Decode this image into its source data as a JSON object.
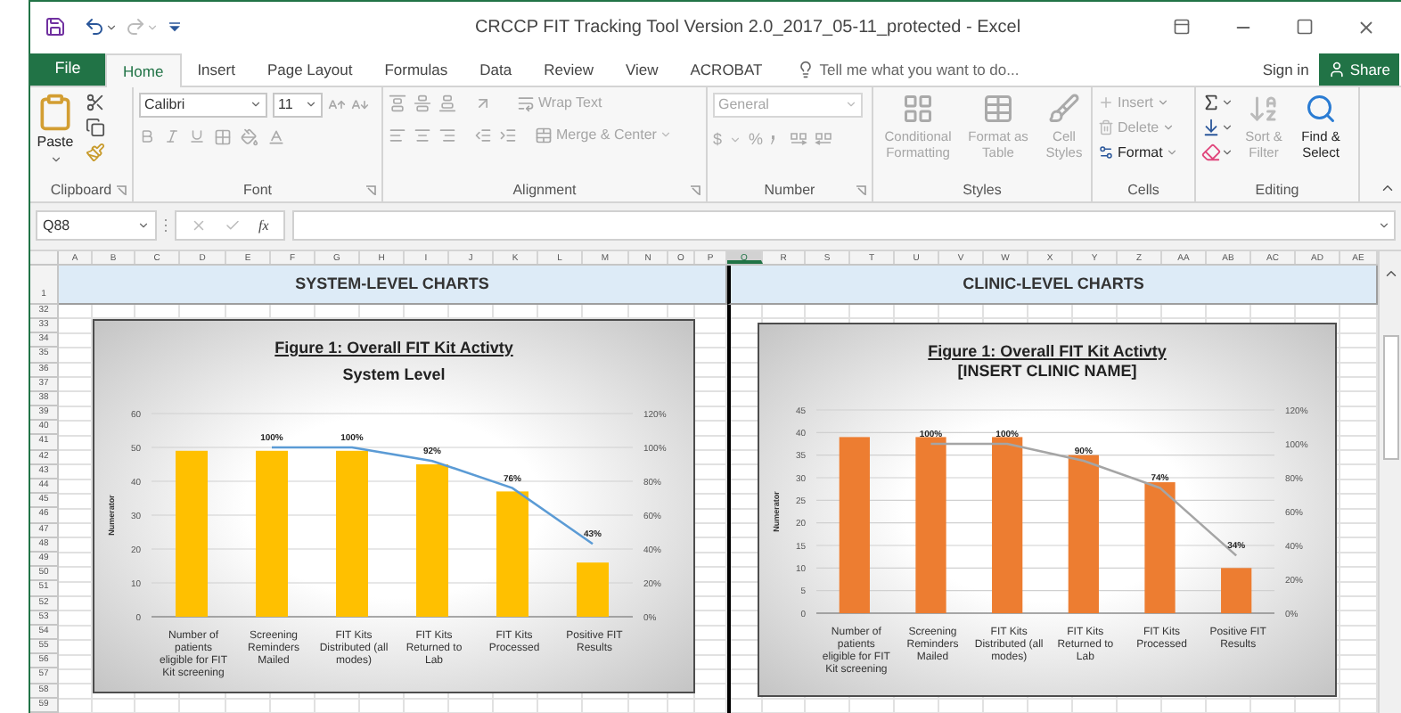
{
  "window": {
    "title": "CRCCP FIT Tracking Tool Version 2.0_2017_05-11_protected - Excel"
  },
  "tabs": [
    {
      "label": "File",
      "kind": "file",
      "selected": false
    },
    {
      "label": "Home",
      "kind": "tab",
      "selected": true
    },
    {
      "label": "Insert",
      "kind": "tab",
      "selected": false
    },
    {
      "label": "Page Layout",
      "kind": "tab",
      "selected": false
    },
    {
      "label": "Formulas",
      "kind": "tab",
      "selected": false
    },
    {
      "label": "Data",
      "kind": "tab",
      "selected": false
    },
    {
      "label": "Review",
      "kind": "tab",
      "selected": false
    },
    {
      "label": "View",
      "kind": "tab",
      "selected": false
    },
    {
      "label": "ACROBAT",
      "kind": "tab",
      "selected": false
    }
  ],
  "tell_me": {
    "placeholder": "Tell me what you want to do..."
  },
  "account": {
    "sign_in": "Sign in",
    "share": "Share"
  },
  "ribbon": {
    "clipboard": {
      "label": "Clipboard",
      "paste": {
        "label": "Paste",
        "disabled": false
      }
    },
    "font": {
      "label": "Font",
      "font_name": "Calibri",
      "font_size": "11"
    },
    "alignment": {
      "label": "Alignment",
      "wrap_text": {
        "label": "Wrap Text",
        "disabled": true
      },
      "merge": {
        "label": "Merge & Center",
        "disabled": true
      }
    },
    "number": {
      "label": "Number",
      "format": {
        "value": "General",
        "disabled": true
      },
      "currency": "$",
      "percent": "%"
    },
    "styles": {
      "label": "Styles",
      "buttons": [
        {
          "label": "Conditional Formatting",
          "disabled": true
        },
        {
          "label": "Format as Table",
          "disabled": true
        },
        {
          "label": "Cell Styles",
          "disabled": true
        }
      ]
    },
    "cells": {
      "label": "Cells",
      "buttons": [
        {
          "label": "Insert",
          "disabled": true
        },
        {
          "label": "Delete",
          "disabled": true
        },
        {
          "label": "Format",
          "disabled": false
        }
      ]
    },
    "editing": {
      "label": "Editing",
      "sort": {
        "label": "Sort & Filter",
        "disabled": true
      },
      "find": {
        "label": "Find & Select",
        "disabled": false
      }
    }
  },
  "formula_bar": {
    "name_box": "Q88",
    "function_label": "fx"
  },
  "sheet": {
    "columns": [
      {
        "label": "A",
        "selected": false
      },
      {
        "label": "B",
        "selected": false
      },
      {
        "label": "C",
        "selected": false
      },
      {
        "label": "D",
        "selected": false
      },
      {
        "label": "E",
        "selected": false
      },
      {
        "label": "F",
        "selected": false
      },
      {
        "label": "G",
        "selected": false
      },
      {
        "label": "H",
        "selected": false
      },
      {
        "label": "I",
        "selected": false
      },
      {
        "label": "J",
        "selected": false
      },
      {
        "label": "K",
        "selected": false
      },
      {
        "label": "L",
        "selected": false
      },
      {
        "label": "M",
        "selected": false
      },
      {
        "label": "N",
        "selected": false
      },
      {
        "label": "O",
        "selected": false
      },
      {
        "label": "P",
        "selected": false
      },
      {
        "label": "Q",
        "selected": true
      },
      {
        "label": "R",
        "selected": false
      },
      {
        "label": "S",
        "selected": false
      },
      {
        "label": "T",
        "selected": false
      },
      {
        "label": "U",
        "selected": false
      },
      {
        "label": "V",
        "selected": false
      },
      {
        "label": "W",
        "selected": false
      },
      {
        "label": "X",
        "selected": false
      },
      {
        "label": "Y",
        "selected": false
      },
      {
        "label": "Z",
        "selected": false
      },
      {
        "label": "AA",
        "selected": false
      },
      {
        "label": "AB",
        "selected": false
      },
      {
        "label": "AC",
        "selected": false
      },
      {
        "label": "AD",
        "selected": false
      },
      {
        "label": "AE",
        "selected": false
      }
    ],
    "rows": [
      "1",
      "32",
      "33",
      "34",
      "35",
      "36",
      "37",
      "38",
      "39",
      "40",
      "41",
      "42",
      "43",
      "44",
      "45",
      "46",
      "47",
      "48",
      "49",
      "50",
      "51",
      "52",
      "53",
      "54",
      "55",
      "56",
      "57",
      "58",
      "59"
    ],
    "sections": [
      {
        "label": "SYSTEM-LEVEL CHARTS"
      },
      {
        "label": "CLINIC-LEVEL CHARTS"
      }
    ]
  },
  "charts": [
    {
      "title": "Figure 1: Overall FIT Kit Activty",
      "subtitle": "System Level",
      "chart_data": {
        "type": "bar",
        "ylabel": "Numerator",
        "grid": true,
        "categories": [
          "Number of patients eligible for FIT Kit screening",
          "Screening Reminders Mailed",
          "FIT Kits Distributed (all modes)",
          "FIT Kits Returned to Lab",
          "FIT Kits Processed",
          "Positive FIT Results"
        ],
        "ylim": [
          0,
          60
        ],
        "yticks": [
          0,
          10,
          20,
          30,
          40,
          50,
          60
        ],
        "series": [
          {
            "color": "#ffc000",
            "values": [
              49,
              49,
              49,
              45,
              37,
              16
            ]
          }
        ]
      },
      "percent_line": {
        "color": "#5b9bd5",
        "axis_ticks": [
          "120%",
          "100%",
          "80%",
          "60%",
          "40%",
          "20%",
          "0%"
        ],
        "points": [
          "100%",
          "100%",
          "92%",
          "76%",
          "43%"
        ]
      }
    },
    {
      "title": "Figure 1: Overall FIT Kit Activty",
      "subtitle": "[INSERT CLINIC NAME]",
      "chart_data": {
        "type": "bar",
        "ylabel": "Numerator",
        "grid": true,
        "categories": [
          "Number of patients eligible for FIT Kit screening",
          "Screening Reminders Mailed",
          "FIT Kits Distributed (all modes)",
          "FIT Kits Returned to Lab",
          "FIT Kits Processed",
          "Positive FIT Results"
        ],
        "ylim": [
          0,
          45
        ],
        "yticks": [
          0,
          5,
          10,
          15,
          20,
          25,
          30,
          35,
          40,
          45
        ],
        "series": [
          {
            "color": "#ed7d31",
            "values": [
              39,
              39,
              39,
              35,
              29,
              10
            ]
          }
        ]
      },
      "percent_line": {
        "color": "#a5a5a5",
        "axis_ticks": [
          "120%",
          "100%",
          "80%",
          "60%",
          "40%",
          "20%",
          "0%"
        ],
        "points": [
          "100%",
          "100%",
          "90%",
          "74%",
          "34%"
        ]
      }
    }
  ]
}
